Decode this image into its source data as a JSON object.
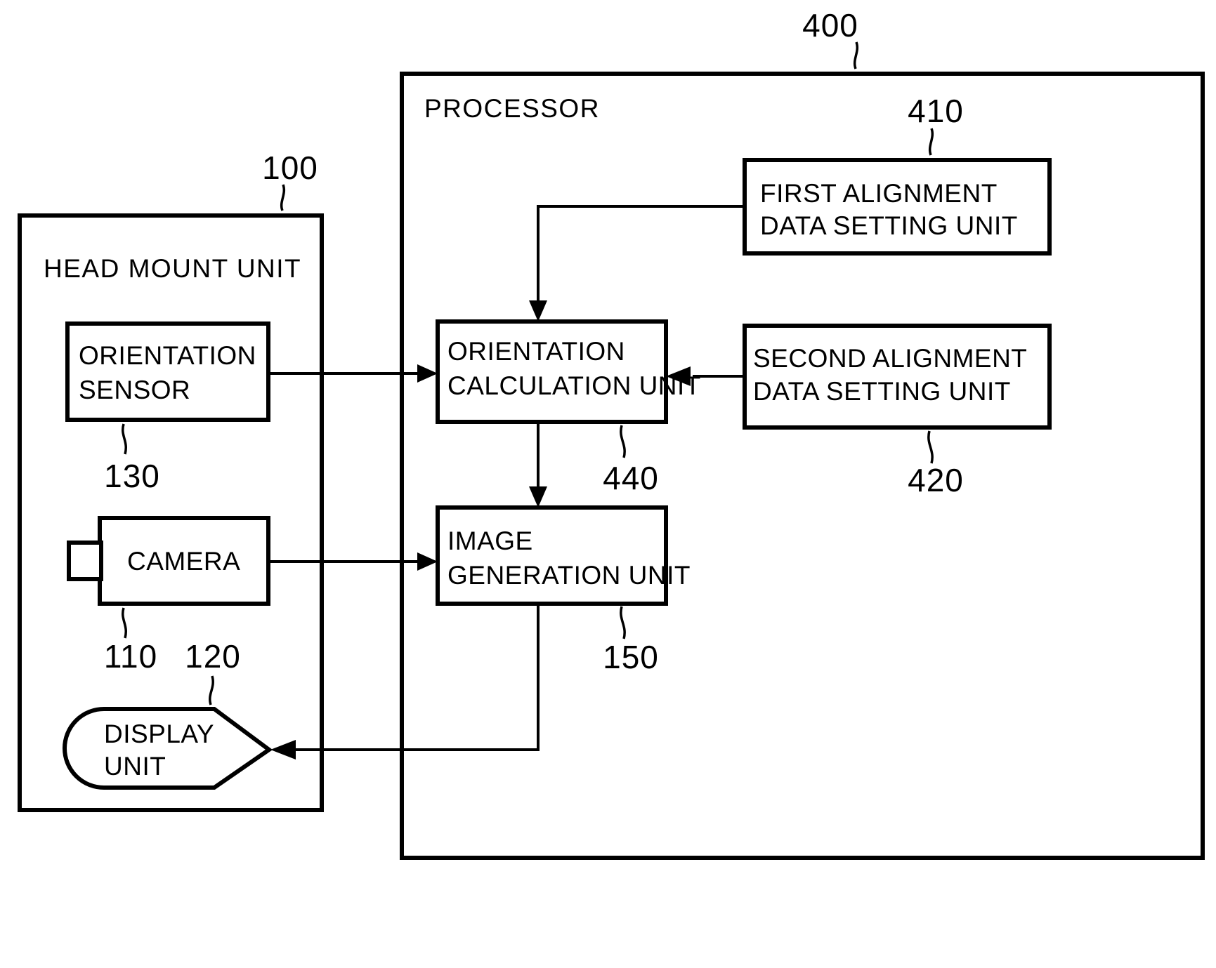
{
  "figure": {
    "type": "patent-block-diagram",
    "blocks": [
      {
        "id": "head_mount_unit",
        "label": "HEAD MOUNT UNIT",
        "ref": "100"
      },
      {
        "id": "processor",
        "label": "PROCESSOR",
        "ref": "400"
      },
      {
        "id": "orientation_sensor",
        "label_line1": "ORIENTATION",
        "label_line2": "SENSOR",
        "ref": "130"
      },
      {
        "id": "camera",
        "label": "CAMERA",
        "ref": "110"
      },
      {
        "id": "display_unit",
        "label_line1": "DISPLAY",
        "label_line2": "UNIT",
        "ref": "120"
      },
      {
        "id": "orientation_calculation_unit",
        "label_line1": "ORIENTATION",
        "label_line2": "CALCULATION UNIT",
        "ref": "440"
      },
      {
        "id": "image_generation_unit",
        "label_line1": "IMAGE",
        "label_line2": "GENERATION UNIT",
        "ref": "150"
      },
      {
        "id": "first_alignment_data_setting_unit",
        "label_line1": "FIRST ALIGNMENT",
        "label_line2": "DATA SETTING UNIT",
        "ref": "410"
      },
      {
        "id": "second_alignment_data_setting_unit",
        "label_line1": "SECOND ALIGNMENT",
        "label_line2": "DATA SETTING UNIT",
        "ref": "420"
      }
    ],
    "connections": [
      {
        "from": "orientation_sensor",
        "to": "orientation_calculation_unit",
        "arrow": "to"
      },
      {
        "from": "camera",
        "to": "image_generation_unit",
        "arrow": "to"
      },
      {
        "from": "first_alignment_data_setting_unit",
        "to": "orientation_calculation_unit",
        "arrow": "to"
      },
      {
        "from": "second_alignment_data_setting_unit",
        "to": "orientation_calculation_unit",
        "arrow": "to"
      },
      {
        "from": "orientation_calculation_unit",
        "to": "image_generation_unit",
        "arrow": "to"
      },
      {
        "from": "image_generation_unit",
        "to": "display_unit",
        "arrow": "to"
      }
    ],
    "labels": {
      "head_mount_unit": "HEAD MOUNT UNIT",
      "processor": "PROCESSOR",
      "orientation_sensor_l1": "ORIENTATION",
      "orientation_sensor_l2": "SENSOR",
      "camera": "CAMERA",
      "display_unit_l1": "DISPLAY",
      "display_unit_l2": "UNIT",
      "orientation_calculation_l1": "ORIENTATION",
      "orientation_calculation_l2": "CALCULATION UNIT",
      "image_generation_l1": "IMAGE",
      "image_generation_l2": "GENERATION UNIT",
      "first_alignment_l1": "FIRST ALIGNMENT",
      "first_alignment_l2": "DATA SETTING UNIT",
      "second_alignment_l1": "SECOND ALIGNMENT",
      "second_alignment_l2": "DATA SETTING UNIT"
    },
    "reference_numerals": {
      "ref_400": "400",
      "ref_410": "410",
      "ref_100": "100",
      "ref_130": "130",
      "ref_110": "110",
      "ref_120": "120",
      "ref_440": "440",
      "ref_420": "420",
      "ref_150": "150"
    },
    "colors": {
      "ink": "#000000",
      "paper": "#ffffff"
    }
  }
}
